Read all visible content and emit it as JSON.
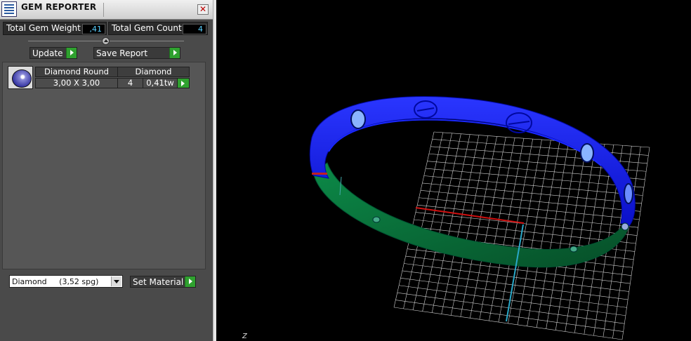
{
  "window": {
    "title": "GEM REPORTER"
  },
  "summary": {
    "total_weight_label": "Total Gem Weight",
    "total_weight_value": ",41",
    "total_count_label": "Total Gem Count",
    "total_count_value": "4"
  },
  "toolbar": {
    "update_label": "Update",
    "save_report_label": "Save Report"
  },
  "gem_table": {
    "headers": [
      "Diamond Round",
      "Diamond"
    ],
    "row": {
      "size": "3,00 X 3,00",
      "count": "4",
      "weight": "0,41tw"
    }
  },
  "material": {
    "selected": "Diamond     (3,52 spg)",
    "set_label": "Set Material"
  },
  "viewport": {
    "axis_label": "Z",
    "colors": {
      "bangle_top": "#0a14e0",
      "bangle_inner": "#0a6e3a",
      "grid": "#cfcfcf",
      "x_axis": "#d01010",
      "y_axis": "#2aa8c8"
    }
  }
}
